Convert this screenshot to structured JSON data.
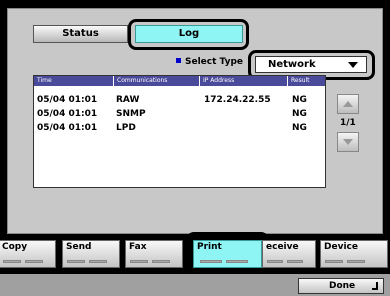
{
  "tabs": {
    "status": "Status",
    "log": "Log"
  },
  "select_type": {
    "label": "Select Type",
    "value": "Network"
  },
  "columns": [
    "Time",
    "Communications",
    "IP Address",
    "Result"
  ],
  "rows": [
    {
      "time": "05/04 01:01",
      "comm": "RAW",
      "ip": "172.24.22.55",
      "result": "NG"
    },
    {
      "time": "05/04 01:01",
      "comm": "SNMP",
      "ip": "",
      "result": "NG"
    },
    {
      "time": "05/04 01:01",
      "comm": "LPD",
      "ip": "",
      "result": "NG"
    }
  ],
  "page": "1/1",
  "bottom_tabs": {
    "copy": "Copy",
    "send": "Send",
    "fax": "Fax",
    "print": "Print",
    "receive": "eceive",
    "device": "Device"
  },
  "done": "Done",
  "colors": {
    "selected": "#8ff4f4",
    "panel": "#c8c8c8",
    "list_header": "#4a4a9a"
  }
}
